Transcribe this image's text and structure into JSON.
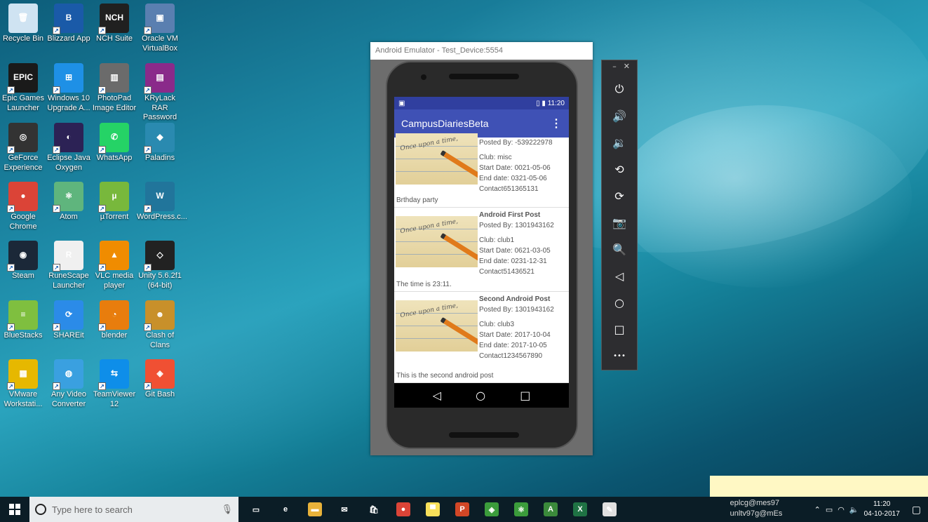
{
  "desktop_icons": [
    {
      "label": "Recycle Bin",
      "icon": "recycle-bin-icon",
      "color": "#cfe3f2",
      "glyph": "🗑"
    },
    {
      "label": "Blizzard App",
      "icon": "blizzard-icon",
      "color": "#1a5aa8",
      "glyph": "B"
    },
    {
      "label": "NCH Suite",
      "icon": "nch-icon",
      "color": "#202020",
      "glyph": "NCH"
    },
    {
      "label": "Oracle VM VirtualBox",
      "icon": "virtualbox-icon",
      "color": "#5a7fb0",
      "glyph": "▣"
    },
    {
      "label": "Epic Games Launcher",
      "icon": "epic-games-icon",
      "color": "#1a1a1a",
      "glyph": "EPIC"
    },
    {
      "label": "Windows 10 Upgrade A...",
      "icon": "windows-icon",
      "color": "#1e90e6",
      "glyph": "⊞"
    },
    {
      "label": "PhotoPad Image Editor",
      "icon": "photopad-icon",
      "color": "#6b6b6b",
      "glyph": "▥"
    },
    {
      "label": "KRyLack RAR Password R...",
      "icon": "winrar-icon",
      "color": "#8a2a8a",
      "glyph": "▤"
    },
    {
      "label": "GeForce Experience",
      "icon": "geforce-icon",
      "color": "#333",
      "glyph": "◎"
    },
    {
      "label": "Eclipse Java Oxygen",
      "icon": "eclipse-icon",
      "color": "#2c2255",
      "glyph": "◐"
    },
    {
      "label": "WhatsApp",
      "icon": "whatsapp-icon",
      "color": "#25d366",
      "glyph": "✆"
    },
    {
      "label": "Paladins",
      "icon": "paladins-icon",
      "color": "#2a8ab0",
      "glyph": "◆"
    },
    {
      "label": "Google Chrome",
      "icon": "chrome-icon",
      "color": "#db4437",
      "glyph": "●"
    },
    {
      "label": "Atom",
      "icon": "atom-icon",
      "color": "#5fb57d",
      "glyph": "⚛"
    },
    {
      "label": "µTorrent",
      "icon": "utorrent-icon",
      "color": "#78b83c",
      "glyph": "µ"
    },
    {
      "label": "WordPress.c...",
      "icon": "wordpress-icon",
      "color": "#21759b",
      "glyph": "W"
    },
    {
      "label": "Steam",
      "icon": "steam-icon",
      "color": "#1b2838",
      "glyph": "◉"
    },
    {
      "label": "RuneScape Launcher",
      "icon": "runescape-icon",
      "color": "#f0f0f0",
      "glyph": "R"
    },
    {
      "label": "VLC media player",
      "icon": "vlc-icon",
      "color": "#f08c00",
      "glyph": "▲"
    },
    {
      "label": "Unity 5.6.2f1 (64-bit)",
      "icon": "unity-icon",
      "color": "#222",
      "glyph": "◇"
    },
    {
      "label": "BlueStacks",
      "icon": "bluestacks-icon",
      "color": "#7fbf3f",
      "glyph": "≡"
    },
    {
      "label": "SHAREit",
      "icon": "shareit-icon",
      "color": "#2b8be8",
      "glyph": "⟳"
    },
    {
      "label": "blender",
      "icon": "blender-icon",
      "color": "#e87d0d",
      "glyph": "◔"
    },
    {
      "label": "Clash of Clans",
      "icon": "clash-of-clans-icon",
      "color": "#c8902a",
      "glyph": "☻"
    },
    {
      "label": "VMware Workstati...",
      "icon": "vmware-icon",
      "color": "#e6b800",
      "glyph": "▦"
    },
    {
      "label": "Any Video Converter",
      "icon": "video-converter-icon",
      "color": "#3aa0e0",
      "glyph": "◍"
    },
    {
      "label": "TeamViewer 12",
      "icon": "teamviewer-icon",
      "color": "#0e8ee9",
      "glyph": "⇆"
    },
    {
      "label": "Git Bash",
      "icon": "git-bash-icon",
      "color": "#f05033",
      "glyph": "◈"
    }
  ],
  "emulator": {
    "title": "Android Emulator - Test_Device:5554",
    "status_time": "11:20",
    "app_title": "CampusDiariesBeta",
    "menu_glyph": "⋮",
    "posts": [
      {
        "title": "",
        "posted_by": "Posted By: -539222978",
        "club": "Club: misc",
        "start": "Start Date: 0021-05-06",
        "end": "End date: 0321-05-06",
        "contact": "Contact651365131",
        "description": "Brthday party",
        "image_text": "Once upon a time,"
      },
      {
        "title": "Android First Post",
        "posted_by": "Posted By: 1301943162",
        "club": "Club: club1",
        "start": "Start Date: 0621-03-05",
        "end": "End date: 0231-12-31",
        "contact": "Contact51436521",
        "description": "The time is 23:11.",
        "image_text": "Once upon a time,"
      },
      {
        "title": "Second Android Post",
        "posted_by": "Posted By: 1301943162",
        "club": "Club: club3",
        "start": "Start Date: 2017-10-04",
        "end": "End date: 2017-10-05",
        "contact": "Contact1234567890",
        "description": "This is the second android post",
        "image_text": "Once upon a time,"
      }
    ],
    "nav": {
      "back": "◁",
      "home": "○",
      "recents": "□"
    }
  },
  "toolbar": {
    "minimize": "–",
    "close": "✕",
    "buttons": [
      {
        "name": "power-icon",
        "glyph": "⏻"
      },
      {
        "name": "volume-up-icon",
        "glyph": "🔊"
      },
      {
        "name": "volume-down-icon",
        "glyph": "🔉"
      },
      {
        "name": "rotate-left-icon",
        "glyph": "⟲"
      },
      {
        "name": "rotate-right-icon",
        "glyph": "⟳"
      },
      {
        "name": "camera-icon",
        "glyph": "📷"
      },
      {
        "name": "zoom-icon",
        "glyph": "🔍"
      },
      {
        "name": "back-icon",
        "glyph": "◁"
      },
      {
        "name": "home-icon",
        "glyph": "○"
      },
      {
        "name": "overview-icon",
        "glyph": "□"
      },
      {
        "name": "more-icon",
        "glyph": "•••"
      }
    ]
  },
  "taskbar": {
    "search_placeholder": "Type here to search",
    "apps": [
      {
        "name": "task-view-icon",
        "glyph": "▭",
        "color": "#0b1d26"
      },
      {
        "name": "edge-icon",
        "glyph": "e",
        "color": "#0b1d26"
      },
      {
        "name": "file-explorer-icon",
        "glyph": "▬",
        "color": "#e8b23a"
      },
      {
        "name": "mail-icon",
        "glyph": "✉",
        "color": "#0b1d26"
      },
      {
        "name": "store-icon",
        "glyph": "🛍",
        "color": "#0b1d26"
      },
      {
        "name": "chrome-taskbar-icon",
        "glyph": "●",
        "color": "#db4437"
      },
      {
        "name": "sticky-notes-icon",
        "glyph": "▀",
        "color": "#f7e05a"
      },
      {
        "name": "powerpoint-icon",
        "glyph": "P",
        "color": "#d24726"
      },
      {
        "name": "git-taskbar-icon",
        "glyph": "◈",
        "color": "#3b9c3b"
      },
      {
        "name": "atom-taskbar-icon",
        "glyph": "⚛",
        "color": "#3b9c3b"
      },
      {
        "name": "android-studio-icon",
        "glyph": "A",
        "color": "#3b8a3b"
      },
      {
        "name": "excel-icon",
        "glyph": "X",
        "color": "#1f7244"
      },
      {
        "name": "notepad-icon",
        "glyph": "✎",
        "color": "#e0e0e0"
      }
    ],
    "notif_line1": "eplcg@mes97",
    "notif_line2": "unltv97g@mEs",
    "time": "11:20",
    "date": "04-10-2017"
  }
}
